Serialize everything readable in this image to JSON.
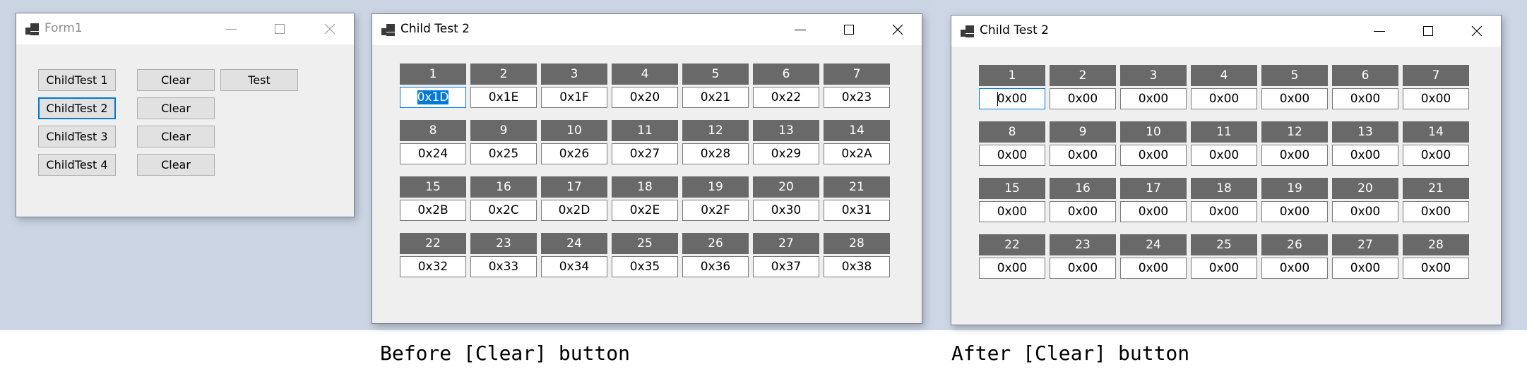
{
  "form1": {
    "title": "Form1",
    "buttons": {
      "childtest": [
        "ChildTest 1",
        "ChildTest 2",
        "ChildTest 3",
        "ChildTest 4"
      ],
      "clear": [
        "Clear",
        "Clear",
        "Clear",
        "Clear"
      ],
      "test": "Test"
    },
    "focused_button": "ChildTest 2"
  },
  "before": {
    "title": "Child Test 2",
    "labels": [
      "1",
      "2",
      "3",
      "4",
      "5",
      "6",
      "7",
      "8",
      "9",
      "10",
      "11",
      "12",
      "13",
      "14",
      "15",
      "16",
      "17",
      "18",
      "19",
      "20",
      "21",
      "22",
      "23",
      "24",
      "25",
      "26",
      "27",
      "28"
    ],
    "values": [
      "0x1D",
      "0x1E",
      "0x1F",
      "0x20",
      "0x21",
      "0x22",
      "0x23",
      "0x24",
      "0x25",
      "0x26",
      "0x27",
      "0x28",
      "0x29",
      "0x2A",
      "0x2B",
      "0x2C",
      "0x2D",
      "0x2E",
      "0x2F",
      "0x30",
      "0x31",
      "0x32",
      "0x33",
      "0x34",
      "0x35",
      "0x36",
      "0x37",
      "0x38"
    ],
    "selected_field": 1,
    "caption": "Before [Clear] button"
  },
  "after": {
    "title": "Child Test 2",
    "labels": [
      "1",
      "2",
      "3",
      "4",
      "5",
      "6",
      "7",
      "8",
      "9",
      "10",
      "11",
      "12",
      "13",
      "14",
      "15",
      "16",
      "17",
      "18",
      "19",
      "20",
      "21",
      "22",
      "23",
      "24",
      "25",
      "26",
      "27",
      "28"
    ],
    "values": [
      "0x00",
      "0x00",
      "0x00",
      "0x00",
      "0x00",
      "0x00",
      "0x00",
      "0x00",
      "0x00",
      "0x00",
      "0x00",
      "0x00",
      "0x00",
      "0x00",
      "0x00",
      "0x00",
      "0x00",
      "0x00",
      "0x00",
      "0x00",
      "0x00",
      "0x00",
      "0x00",
      "0x00",
      "0x00",
      "0x00",
      "0x00",
      "0x00"
    ],
    "focused_field": 1,
    "caption": "After [Clear] button"
  },
  "colors": {
    "header_cell": "#696969",
    "focus_accent": "#0078d7",
    "desktop": "#cbd5e3"
  }
}
